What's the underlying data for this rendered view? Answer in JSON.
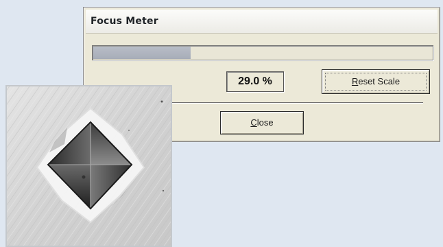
{
  "dialog": {
    "title": "Focus Meter",
    "progress": 0.29,
    "value_text": "29.0 %",
    "reset_button": {
      "prefix": "",
      "mnemonic": "R",
      "suffix": "eset Scale"
    },
    "close_button": {
      "prefix": "",
      "mnemonic": "C",
      "suffix": "lose"
    }
  },
  "colors": {
    "background": "#dfe7f1",
    "dialog_face": "#ece9d8",
    "progress_fill": "#aab0bb"
  },
  "image": {
    "subject": "pyramidal-indentation-micrograph"
  }
}
